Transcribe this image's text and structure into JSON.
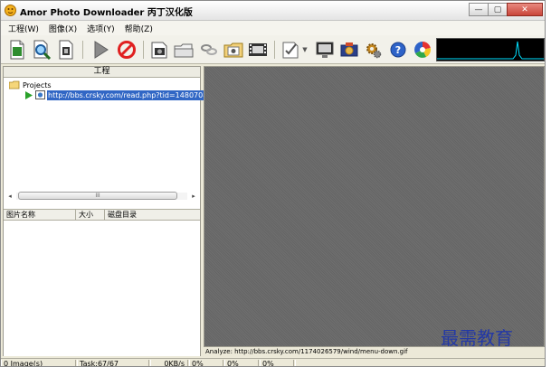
{
  "window": {
    "title": "Amor Photo Downloader 丙丁汉化版",
    "controls": [
      "minimize",
      "maximize",
      "close"
    ]
  },
  "menu": {
    "items": [
      "工程(W)",
      "图像(X)",
      "选项(Y)",
      "帮助(Z)"
    ]
  },
  "toolbar": {
    "buttons": [
      {
        "name": "new-project",
        "icon": "new-document-icon"
      },
      {
        "name": "search",
        "icon": "magnifier-icon"
      },
      {
        "name": "properties",
        "icon": "document-gear-icon"
      },
      {
        "name": "start",
        "icon": "play-icon"
      },
      {
        "name": "stop",
        "icon": "stop-icon"
      },
      {
        "name": "download",
        "icon": "camera-download-icon"
      },
      {
        "name": "open-folder",
        "icon": "folder-icon"
      },
      {
        "name": "links",
        "icon": "chain-icon"
      },
      {
        "name": "gallery",
        "icon": "image-folder-icon"
      },
      {
        "name": "filmstrip",
        "icon": "filmstrip-icon"
      },
      {
        "name": "edit",
        "icon": "checklist-icon"
      },
      {
        "name": "slideshow",
        "icon": "monitor-icon"
      },
      {
        "name": "capture",
        "icon": "camera-icon"
      },
      {
        "name": "settings",
        "icon": "gears-icon"
      },
      {
        "name": "help",
        "icon": "help-icon"
      },
      {
        "name": "about",
        "icon": "color-wheel-icon"
      }
    ],
    "graph_color": "#00e0ff"
  },
  "project_pane": {
    "header": "工程",
    "tree": {
      "root": "Projects",
      "item_url": "http://bbs.crsky.com/read.php?tid=1480708"
    },
    "scroll_thumb_label": "III"
  },
  "image_list": {
    "columns": [
      "图片名称",
      "大小",
      "磁盘目录"
    ]
  },
  "preview": {
    "status_text": "Analyze: http://bbs.crsky.com/1174026579/wind/menu-down.gif"
  },
  "statusbar": {
    "images": "0 Image(s)",
    "task": "Task:67/67",
    "speed": "0KB/s",
    "percents": [
      "0%",
      "0%",
      "0%"
    ]
  },
  "watermark": "最需教育",
  "colors": {
    "selection": "#3167c5",
    "preview_bg": "#6a6a6a",
    "watermark": "#2338a5"
  }
}
